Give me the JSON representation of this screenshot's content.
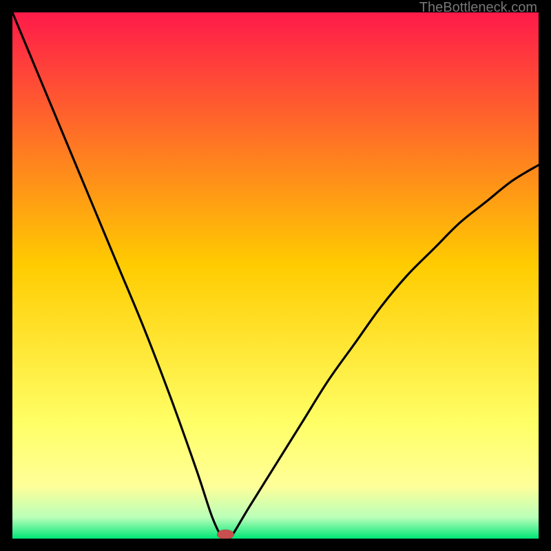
{
  "watermark": "TheBottleneck.com",
  "chart_data": {
    "type": "line",
    "title": "",
    "xlabel": "",
    "ylabel": "",
    "xlim": [
      0,
      100
    ],
    "ylim": [
      0,
      100
    ],
    "colors": {
      "curve": "#000000",
      "gradient_top": "#ff1a4a",
      "gradient_mid": "#ffcc00",
      "gradient_low": "#ffff99",
      "gradient_bottom": "#00e676",
      "marker": "#c94f4f"
    },
    "series": [
      {
        "name": "bottleneck-curve",
        "x": [
          0,
          5,
          10,
          15,
          20,
          25,
          30,
          35,
          38,
          40,
          41,
          42,
          45,
          50,
          55,
          60,
          65,
          70,
          75,
          80,
          85,
          90,
          95,
          100
        ],
        "y": [
          100,
          88,
          76,
          64,
          52,
          40,
          27,
          13,
          4,
          0,
          0,
          1,
          6,
          14,
          22,
          30,
          37,
          44,
          50,
          55,
          60,
          64,
          68,
          71
        ]
      }
    ],
    "marker": {
      "x": 40.5,
      "y": 0,
      "rx": 1.6,
      "ry": 0.9
    }
  }
}
